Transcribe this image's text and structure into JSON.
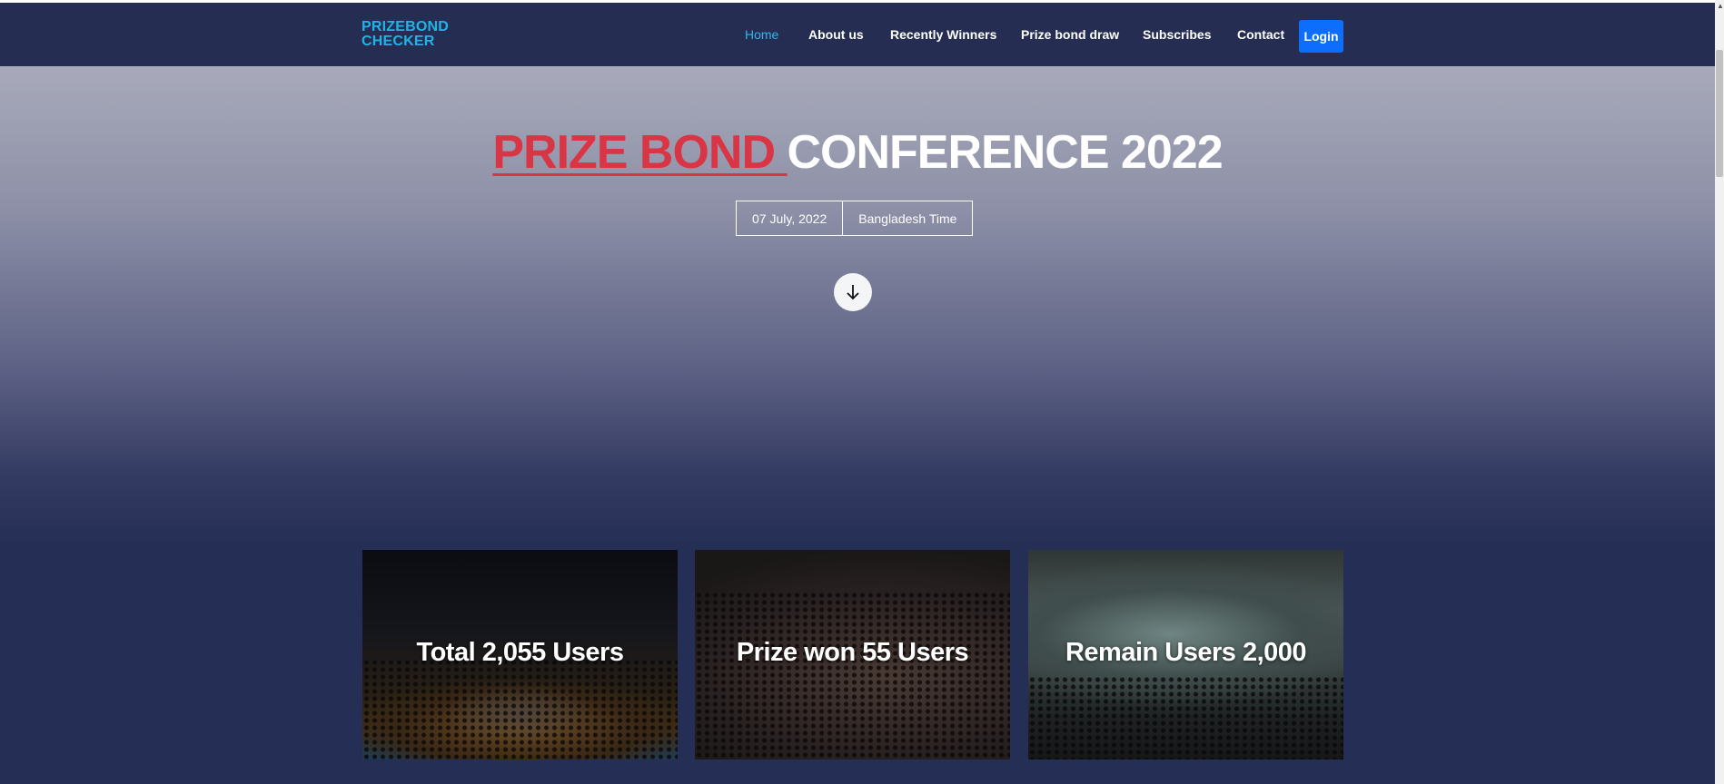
{
  "brand": {
    "line1": "PRIZEBOND",
    "line2": "CHECKER"
  },
  "nav": {
    "items": [
      {
        "label": "Home",
        "active": true
      },
      {
        "label": "About us"
      },
      {
        "label": "Recently Winners"
      },
      {
        "label": "Prize bond draw"
      },
      {
        "label": "Subscribes"
      },
      {
        "label": "Contact"
      }
    ],
    "login_label": "Login"
  },
  "hero": {
    "title_accent": "PRIZE BOND ",
    "title_rest": "CONFERENCE 2022",
    "date": "07 July, 2022",
    "timezone": "Bangladesh Time",
    "scroll_icon": "arrow-down-icon"
  },
  "stats": [
    {
      "label": "Total 2,055 Users"
    },
    {
      "label": "Prize won 55 Users"
    },
    {
      "label": "Remain Users 2,000"
    }
  ],
  "colors": {
    "navbar": "#262d53",
    "brand": "#20b4e6",
    "accent_red": "#d93545",
    "login_button": "#0d6efd"
  }
}
